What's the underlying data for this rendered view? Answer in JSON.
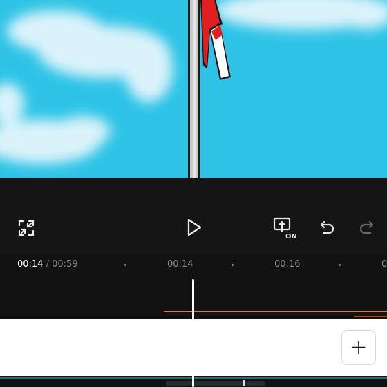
{
  "preview": {
    "colors": {
      "sky": "#2ec3e6",
      "pole": "#c8c8c8",
      "flag_red": "#e02020",
      "flag_white": "#ffffff"
    }
  },
  "toolbar": {
    "fullscreen_icon": "fullscreen-icon",
    "play_icon": "play-icon",
    "keyframe_icon": "keyframe-on-icon",
    "keyframe_badge": "ON",
    "undo_icon": "undo-icon",
    "redo_icon": "redo-icon"
  },
  "timeline": {
    "current_time": "00:14",
    "separator": " / ",
    "total_time": "00:59",
    "ticks": [
      "00:14",
      "00:16",
      "0"
    ]
  },
  "add_button": {
    "label": "+"
  },
  "colors": {
    "accent_track": "#e07a45",
    "background": "#121212"
  }
}
